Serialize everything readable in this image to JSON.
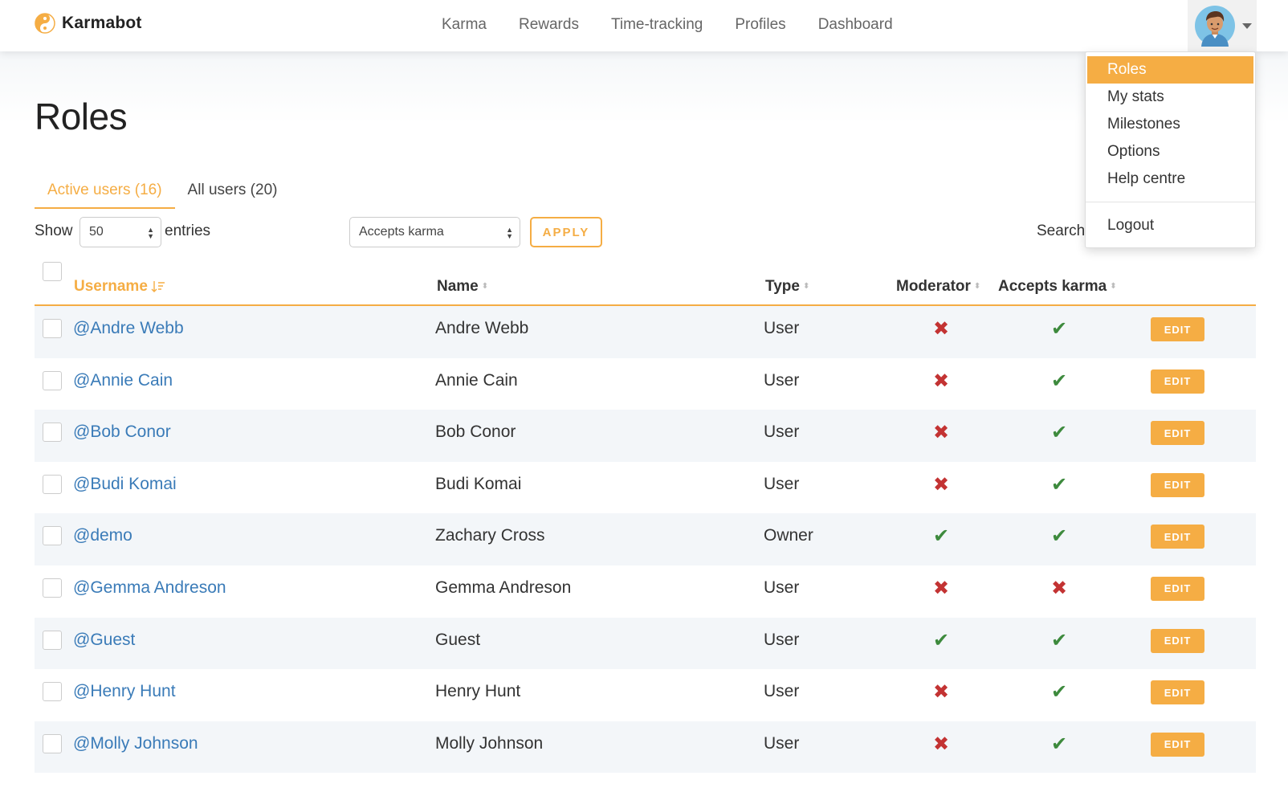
{
  "brand": {
    "name": "Karmabot",
    "logo_icon": "yin-yang-icon",
    "accent_color": "#f5ad44"
  },
  "nav": {
    "links": [
      "Karma",
      "Rewards",
      "Time-tracking",
      "Profiles",
      "Dashboard"
    ]
  },
  "user_menu": {
    "avatar_icon": "user-avatar",
    "items": [
      "Roles",
      "My stats",
      "Milestones",
      "Options",
      "Help centre"
    ],
    "active_item": "Roles",
    "logout_label": "Logout"
  },
  "page": {
    "title": "Roles"
  },
  "tabs": [
    {
      "label": "Active users (16)",
      "active": true
    },
    {
      "label": "All users (20)",
      "active": false
    }
  ],
  "controls": {
    "show_label": "Show",
    "entries_value": "50",
    "entries_label": "entries",
    "filter_value": "Accepts karma",
    "apply_label": "APPLY",
    "search_label": "Search"
  },
  "table": {
    "columns": {
      "username": "Username",
      "name": "Name",
      "type": "Type",
      "moderator": "Moderator",
      "accepts_karma": "Accepts karma"
    },
    "sorted_column": "username",
    "edit_label": "EDIT",
    "status_colors": {
      "yes": "#3d8a3d",
      "no": "#c33333"
    },
    "rows": [
      {
        "username": "@Andre Webb",
        "name": "Andre Webb",
        "type": "User",
        "moderator": false,
        "accepts_karma": true
      },
      {
        "username": "@Annie Cain",
        "name": "Annie Cain",
        "type": "User",
        "moderator": false,
        "accepts_karma": true
      },
      {
        "username": "@Bob Conor",
        "name": "Bob Conor",
        "type": "User",
        "moderator": false,
        "accepts_karma": true
      },
      {
        "username": "@Budi Komai",
        "name": "Budi Komai",
        "type": "User",
        "moderator": false,
        "accepts_karma": true
      },
      {
        "username": "@demo",
        "name": "Zachary Cross",
        "type": "Owner",
        "moderator": true,
        "accepts_karma": true
      },
      {
        "username": "@Gemma Andreson",
        "name": "Gemma Andreson",
        "type": "User",
        "moderator": false,
        "accepts_karma": false
      },
      {
        "username": "@Guest",
        "name": "Guest",
        "type": "User",
        "moderator": true,
        "accepts_karma": true
      },
      {
        "username": "@Henry Hunt",
        "name": "Henry Hunt",
        "type": "User",
        "moderator": false,
        "accepts_karma": true
      },
      {
        "username": "@Molly Johnson",
        "name": "Molly Johnson",
        "type": "User",
        "moderator": false,
        "accepts_karma": true
      }
    ]
  }
}
